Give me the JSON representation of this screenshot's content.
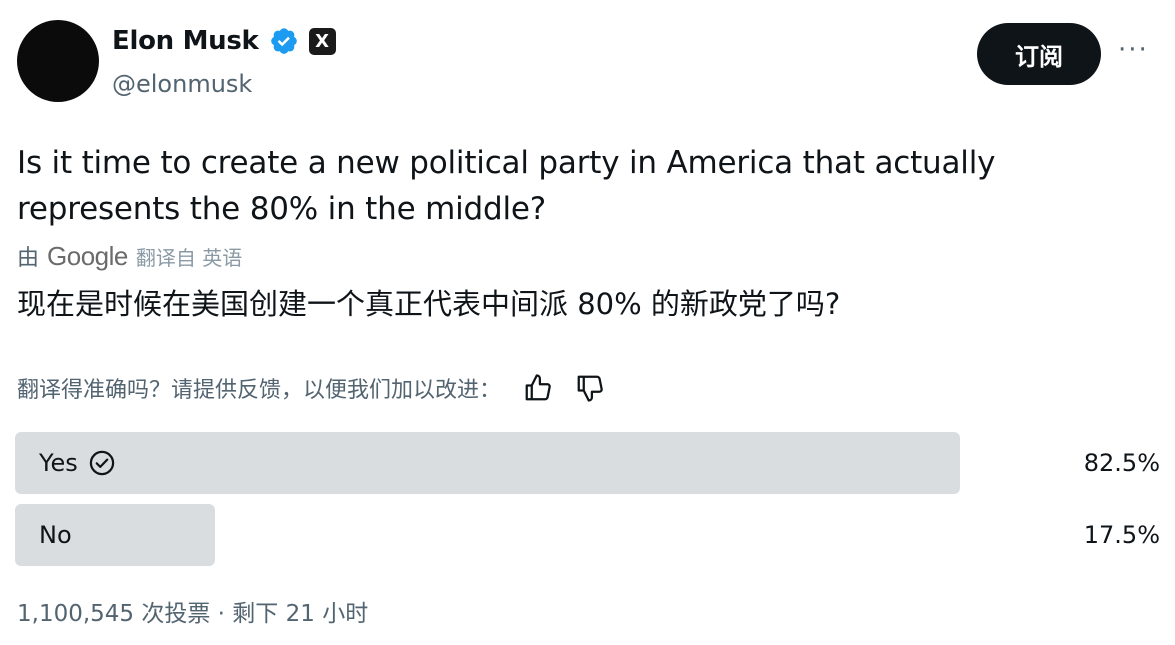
{
  "author": {
    "display_name": "Elon Musk",
    "handle": "@elonmusk",
    "verified_icon": "verified-badge-icon",
    "affiliate_badge": "X"
  },
  "actions": {
    "subscribe_label": "订阅",
    "more_label": "···"
  },
  "tweet": {
    "text": "Is it time to create a new political party in America that actually represents the 80% in the middle?"
  },
  "translation": {
    "by_label": "由",
    "provider": "Google",
    "translated_from_label": "翻译自 英语",
    "text": "现在是时候在美国创建一个真正代表中间派 80% 的新政党了吗?",
    "feedback_prompt": "翻译得准确吗？请提供反馈，以便我们加以改进："
  },
  "poll": {
    "options": [
      {
        "label": "Yes",
        "percent_text": "82.5%",
        "fraction": 0.825,
        "selected": true
      },
      {
        "label": "No",
        "percent_text": "17.5%",
        "fraction": 0.175,
        "selected": false
      }
    ],
    "meta": "1,100,545 次投票 · 剩下 21 小时"
  },
  "colors": {
    "verified_blue": "#1d9bf0",
    "bar": "#d9dde0",
    "text_secondary": "#536471"
  }
}
